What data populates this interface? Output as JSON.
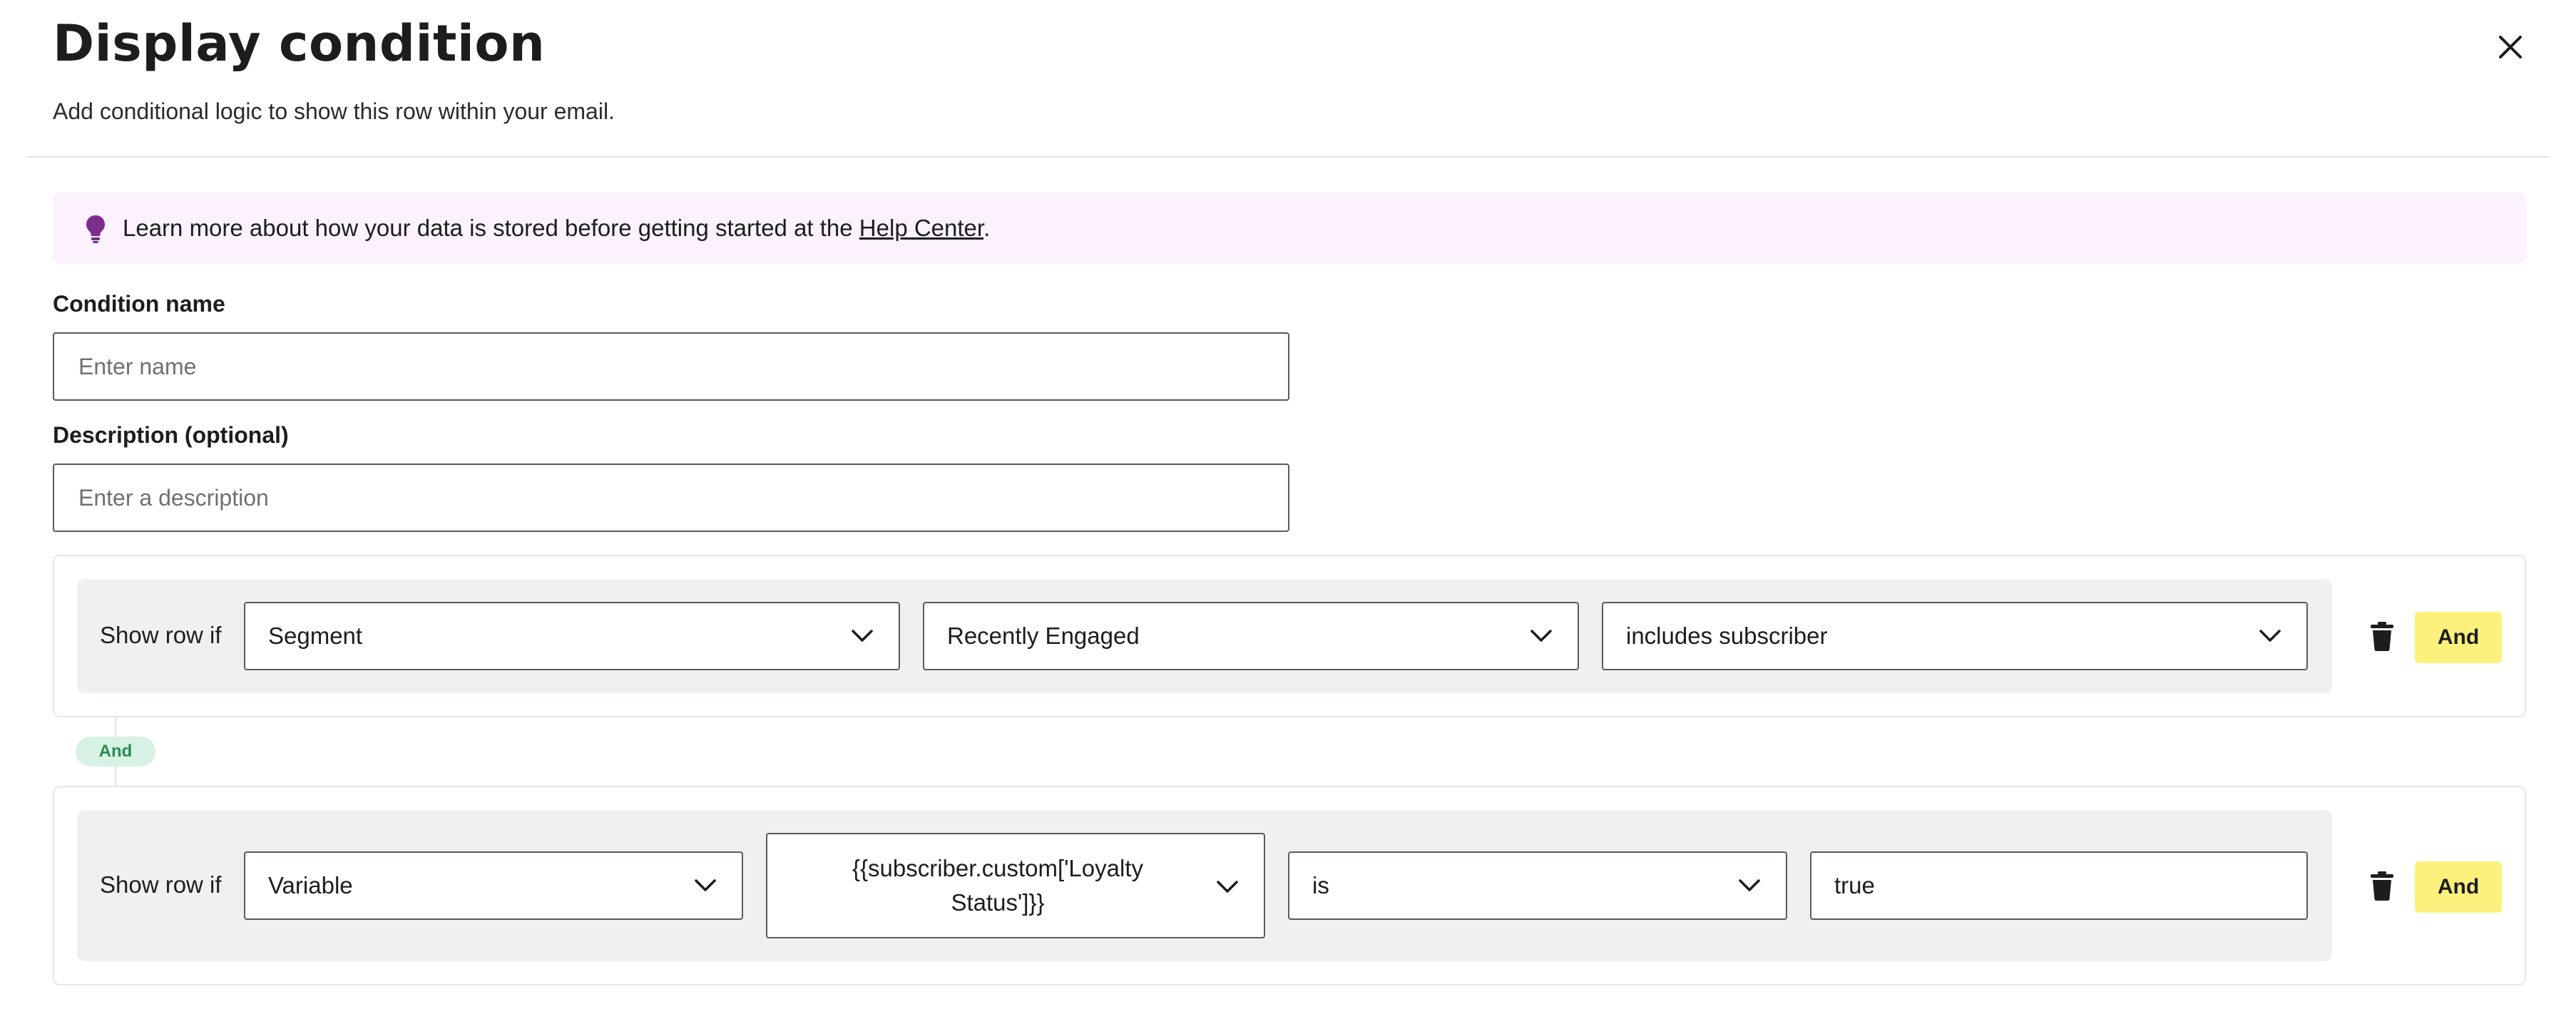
{
  "header": {
    "title": "Display condition",
    "subtitle": "Add conditional logic to show this row within your email."
  },
  "banner": {
    "text_before": "Learn more about how your data is stored before getting started at the ",
    "link_text": "Help Center",
    "text_after": "."
  },
  "form": {
    "name_label": "Condition name",
    "name_placeholder": "Enter name",
    "description_label": "Description (optional)",
    "description_placeholder": "Enter a description"
  },
  "conditions": [
    {
      "label": "Show row if",
      "type": "Segment",
      "subject": "Recently Engaged",
      "operator": "includes subscriber",
      "and_label": "And"
    },
    {
      "label": "Show row if",
      "type": "Variable",
      "subject": "{{subscriber.custom['Loyalty Status']}}",
      "operator": "is",
      "value": "true",
      "and_label": "And"
    }
  ],
  "connector_label": "And",
  "colors": {
    "banner_bg": "#fcf2fd",
    "banner_icon": "#7b2d8e",
    "and_button": "#fdf17e",
    "and_pill_bg": "#d7f1e3",
    "and_pill_text": "#2b8a56",
    "row_bg": "#eff0f0"
  },
  "icons": {
    "close": "close-icon",
    "banner": "lightbulb-icon",
    "chevron": "chevron-down-icon",
    "delete": "trash-icon"
  }
}
